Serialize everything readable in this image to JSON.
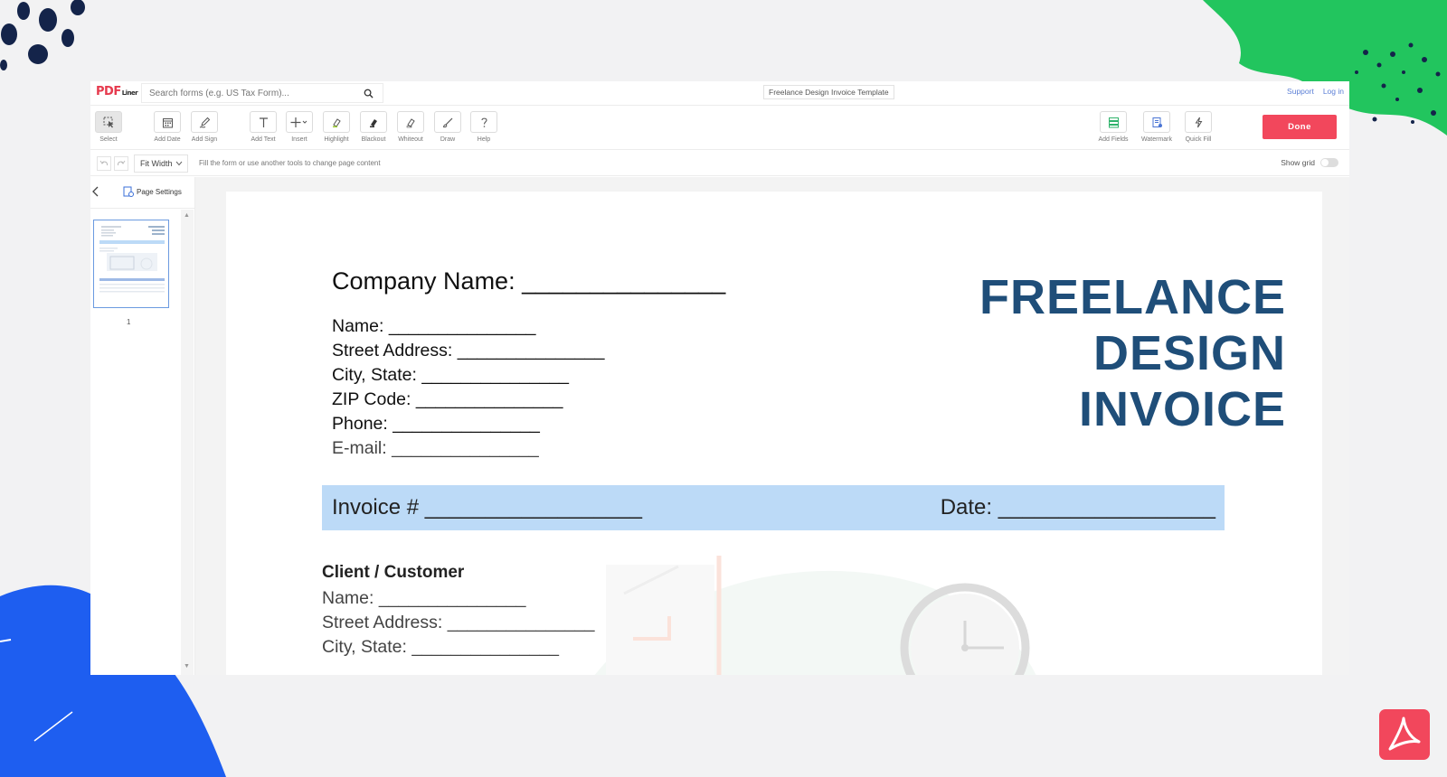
{
  "brand": {
    "logo_main": "PDF",
    "logo_sub": "Liner"
  },
  "search": {
    "placeholder": "Search forms (e.g. US Tax Form)..."
  },
  "document_title": "Freelance Design Invoice Template",
  "top_links": {
    "support": "Support",
    "login": "Log in"
  },
  "toolbar": {
    "tools": [
      {
        "label": "Select",
        "icon": "cursor-icon"
      },
      {
        "label": "Add Date",
        "icon": "calendar-icon"
      },
      {
        "label": "Add Sign",
        "icon": "pen-icon"
      },
      {
        "label": "Add Text",
        "icon": "text-icon"
      },
      {
        "label": "Insert",
        "icon": "plus-icon"
      },
      {
        "label": "Highlight",
        "icon": "highlighter-icon"
      },
      {
        "label": "Blackout",
        "icon": "blackout-icon"
      },
      {
        "label": "Whiteout",
        "icon": "eraser-icon"
      },
      {
        "label": "Draw",
        "icon": "brush-icon"
      },
      {
        "label": "Help",
        "icon": "question-icon"
      }
    ],
    "right_tools": [
      {
        "label": "Add Fields",
        "icon": "fields-icon"
      },
      {
        "label": "Watermark",
        "icon": "watermark-icon"
      },
      {
        "label": "Quick Fill",
        "icon": "lightning-icon"
      }
    ],
    "done_label": "Done"
  },
  "subbar": {
    "zoom": "Fit Width",
    "hint": "Fill the form or use another tools to change page content",
    "show_grid_label": "Show grid"
  },
  "sidebar": {
    "settings_label": "Page Settings",
    "page_number": "1"
  },
  "document": {
    "company": "Company Name: _______________",
    "sender_fields": [
      "Name: _______________",
      "Street Address: _______________",
      "City, State: _______________",
      "ZIP Code: _______________",
      "Phone: _______________",
      "E-mail: _______________"
    ],
    "headline": [
      "FREELANCE",
      "DESIGN",
      "INVOICE"
    ],
    "invoice_label": "Invoice #  __________________",
    "date_label": "Date:  __________________",
    "client_title": "Client / Customer",
    "client_fields": [
      "Name: _______________",
      "Street Address: _______________",
      "City, State: _______________"
    ]
  },
  "colors": {
    "accent": "#f2475c",
    "headline": "#1f4e79",
    "invoice_band": "#bcdaf7",
    "deco_green": "#22c55e",
    "deco_blue": "#1e5ef0",
    "deco_navy": "#14244a"
  }
}
